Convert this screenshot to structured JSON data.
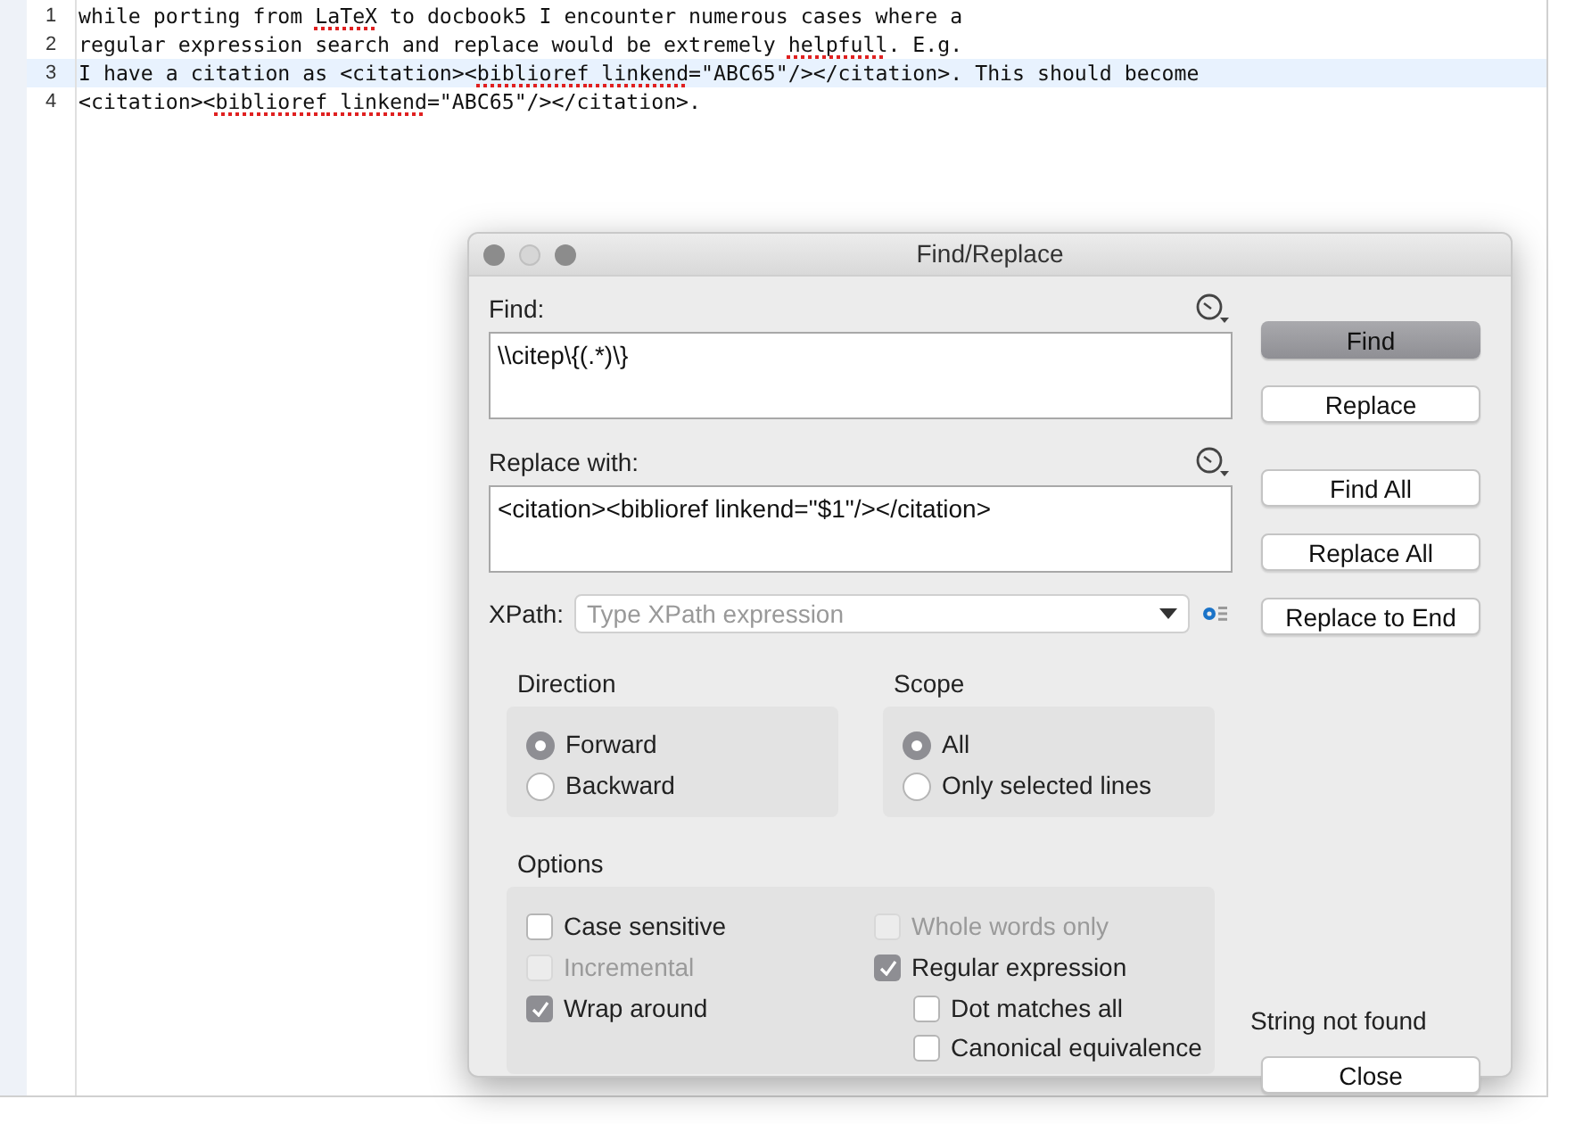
{
  "editor": {
    "lines": [
      {
        "number": "1",
        "current": false,
        "segments": [
          {
            "text": "while porting from ",
            "misspelled": false
          },
          {
            "text": "LaTeX",
            "misspelled": true
          },
          {
            "text": " to docbook5 I encounter numerous cases where a",
            "misspelled": false
          }
        ]
      },
      {
        "number": "2",
        "current": false,
        "segments": [
          {
            "text": "regular expression search and replace would be extremely ",
            "misspelled": false
          },
          {
            "text": "helpfull",
            "misspelled": true
          },
          {
            "text": ". E.g.",
            "misspelled": false
          }
        ]
      },
      {
        "number": "3",
        "current": true,
        "segments": [
          {
            "text": "I have a citation as <citation><",
            "misspelled": false
          },
          {
            "text": "biblioref",
            "misspelled": true
          },
          {
            "text": " linkend",
            "misspelled": true
          },
          {
            "text": "=\"ABC65\"/></citation>. This should become",
            "misspelled": false
          }
        ]
      },
      {
        "number": "4",
        "current": false,
        "segments": [
          {
            "text": "<citation><",
            "misspelled": false
          },
          {
            "text": "biblioref",
            "misspelled": true
          },
          {
            "text": " linkend",
            "misspelled": true
          },
          {
            "text": "=\"ABC65\"/></citation>.",
            "misspelled": false
          }
        ]
      }
    ]
  },
  "dialog": {
    "title": "Find/Replace",
    "find": {
      "label": "Find:",
      "value": "\\\\citep\\{(.*)\\}"
    },
    "replace": {
      "label": "Replace with:",
      "value": "<citation><biblioref linkend=\"$1\"/></citation>"
    },
    "xpath": {
      "label": "XPath:",
      "placeholder": "Type XPath expression"
    },
    "direction": {
      "title": "Direction",
      "options": [
        {
          "label": "Forward",
          "selected": true
        },
        {
          "label": "Backward",
          "selected": false
        }
      ]
    },
    "scope": {
      "title": "Scope",
      "options": [
        {
          "label": "All",
          "selected": true
        },
        {
          "label": "Only selected lines",
          "selected": false
        }
      ]
    },
    "options": {
      "title": "Options",
      "columns": [
        [
          {
            "label": "Case sensitive",
            "checked": false,
            "disabled": false
          },
          {
            "label": "Incremental",
            "checked": false,
            "disabled": true
          },
          {
            "label": "Wrap around",
            "checked": true,
            "disabled": false
          }
        ],
        [
          {
            "label": "Whole words only",
            "checked": false,
            "disabled": true
          },
          {
            "label": "Regular expression",
            "checked": true,
            "disabled": false,
            "children": [
              {
                "label": "Dot matches all",
                "checked": false,
                "disabled": false
              },
              {
                "label": "Canonical equivalence",
                "checked": false,
                "disabled": false
              }
            ]
          }
        ]
      ]
    },
    "buttons": [
      {
        "label": "Find",
        "default": true
      },
      {
        "label": "Replace",
        "default": false
      },
      {
        "label": "Find All",
        "default": false
      },
      {
        "label": "Replace All",
        "default": false
      },
      {
        "label": "Replace to End",
        "default": false
      }
    ],
    "status": "String not found",
    "close_button": "Close"
  }
}
